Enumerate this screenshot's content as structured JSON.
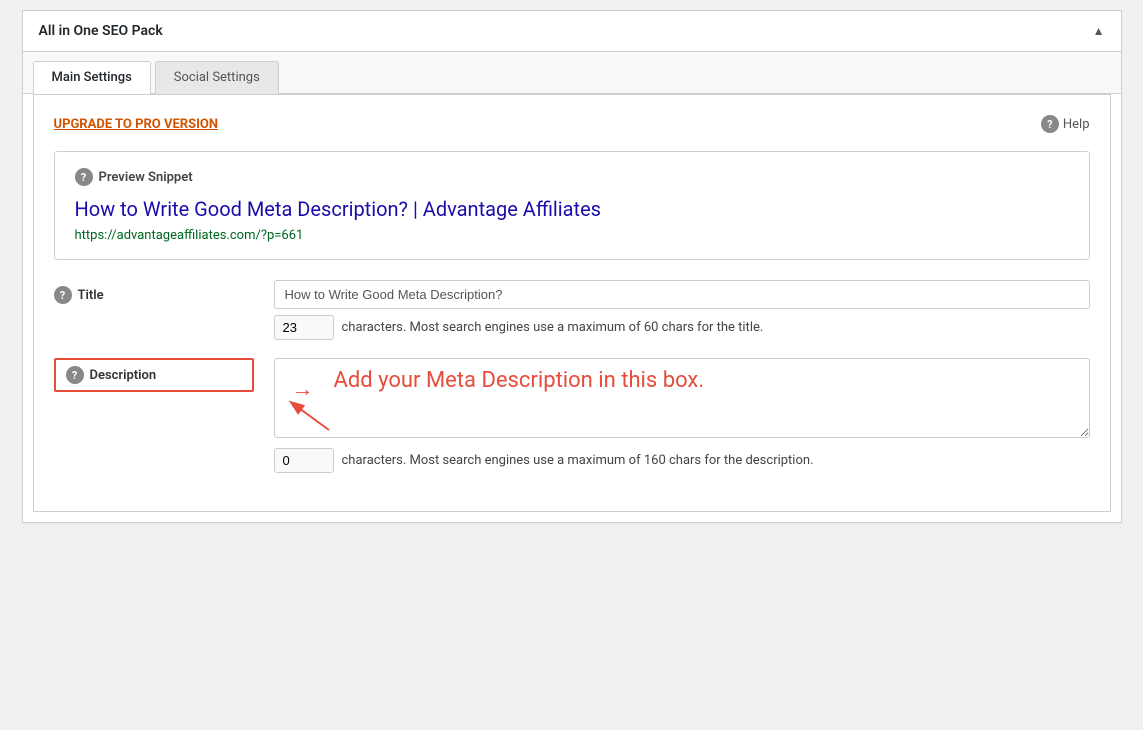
{
  "plugin": {
    "title": "All in One SEO Pack",
    "collapse_icon": "▲"
  },
  "tabs": [
    {
      "label": "Main Settings",
      "active": true
    },
    {
      "label": "Social Settings",
      "active": false
    }
  ],
  "upgrade": {
    "link_text": "UPGRADE TO PRO VERSION"
  },
  "help": {
    "label": "Help",
    "icon": "?"
  },
  "preview": {
    "section_label": "Preview Snippet",
    "title": "How to Write Good Meta Description? | Advantage Affiliates",
    "url": "https://advantageaffiliates.com/?p=661"
  },
  "form": {
    "title_label": "Title",
    "title_value": "How to Write Good Meta Description?",
    "title_char_count": "23",
    "title_char_note": "characters. Most search engines use a maximum of 60 chars for the title.",
    "description_label": "Description",
    "description_char_count": "0",
    "description_char_note": "characters. Most search engines use a maximum of 160 chars for the description.",
    "annotation_text": "Add your Meta Description in this box."
  },
  "icons": {
    "question_mark": "?",
    "arrow_right": "→"
  }
}
